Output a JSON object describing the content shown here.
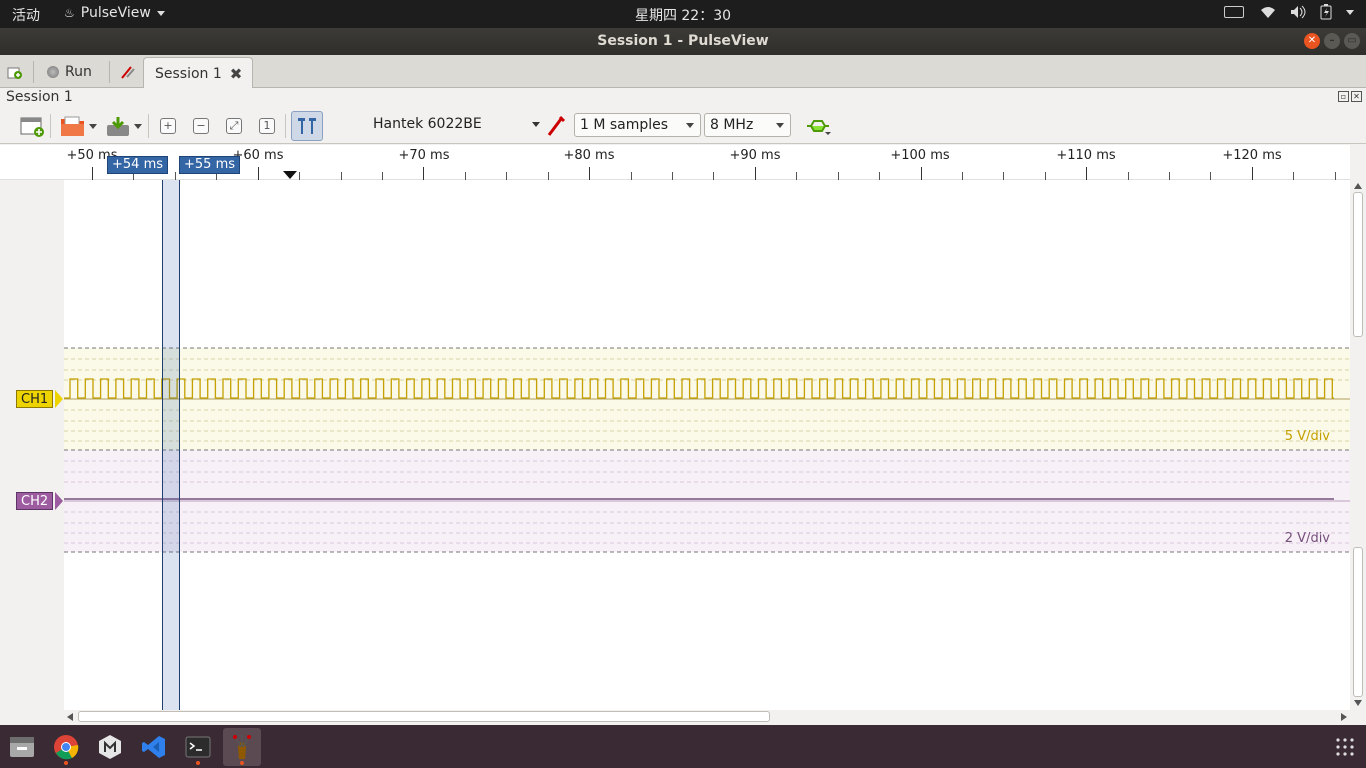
{
  "topbar": {
    "activities": "活动",
    "app_name": "PulseView",
    "clock": "星期四 22：30"
  },
  "window": {
    "title": "Session 1 - PulseView"
  },
  "tabbar": {
    "run_label": "Run",
    "session_tab_label": "Session 1"
  },
  "dock_header": {
    "title": "Session 1"
  },
  "toolbar": {
    "device": "Hantek 6022BE",
    "samples": "1 M samples",
    "samplerate": "8 MHz"
  },
  "ruler": {
    "ticks": [
      "+50 ms",
      "+60 ms",
      "+70 ms",
      "+80 ms",
      "+90 ms",
      "+100 ms",
      "+110 ms",
      "+120 ms"
    ],
    "cursor1": "+54 ms",
    "cursor2": "+55 ms"
  },
  "channels": {
    "ch1": {
      "name": "CH1",
      "scale": "5 V/div",
      "color": "#c4a000"
    },
    "ch2": {
      "name": "CH2",
      "scale": "2 V/div",
      "color": "#75507b"
    }
  },
  "colors": {
    "cursor_band": "#3465a4",
    "accent": "#e95420"
  },
  "icons": {
    "new_session": "new-session-icon",
    "run": "run-icon",
    "settings": "settings-icon",
    "add_view": "add-view-icon",
    "open": "open-file-icon",
    "save": "save-file-icon",
    "zoom_in": "zoom-in-icon",
    "zoom_out": "zoom-out-icon",
    "zoom_fit": "zoom-fit-icon",
    "zoom_one": "zoom-one-to-one-icon",
    "cursor": "cursor-icon",
    "probe": "probe-icon",
    "decoder": "protocol-decoder-icon"
  }
}
